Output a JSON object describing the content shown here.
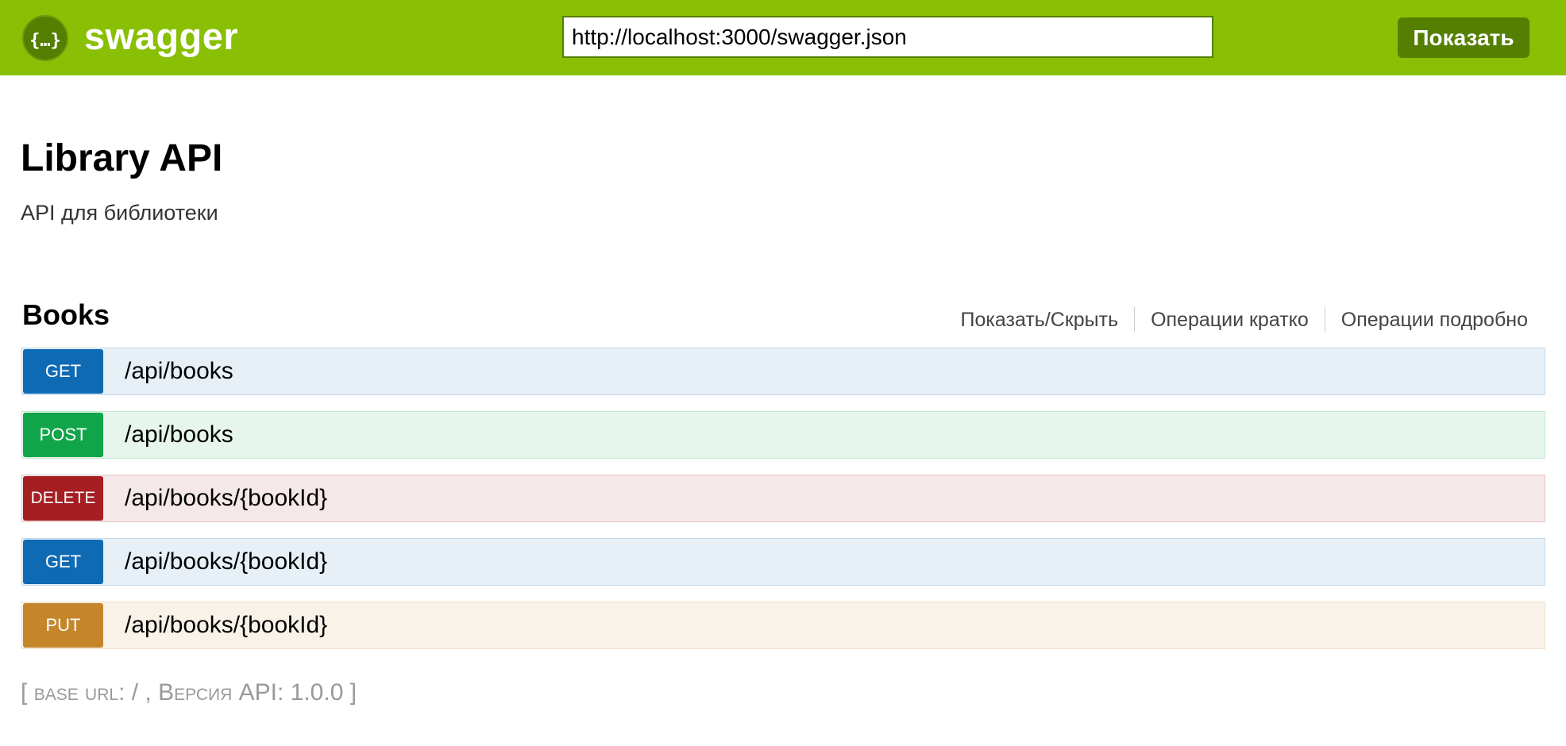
{
  "header": {
    "brand": "swagger",
    "logo_icon": "swagger-braces-icon",
    "url_value": "http://localhost:3000/swagger.json",
    "show_button": "Показать",
    "colors": {
      "bar": "#89bf04",
      "button": "#547f00"
    }
  },
  "info": {
    "title": "Library API",
    "description": "API для библиотеки"
  },
  "resource": {
    "name": "Books",
    "options": {
      "toggle": "Показать/Скрыть",
      "list": "Операции кратко",
      "expand": "Операции подробно"
    },
    "operations": [
      {
        "method": "GET",
        "path": "/api/books",
        "color": "#0f6ab4"
      },
      {
        "method": "POST",
        "path": "/api/books",
        "color": "#10a54a"
      },
      {
        "method": "DELETE",
        "path": "/api/books/{bookId}",
        "color": "#a41e22"
      },
      {
        "method": "GET",
        "path": "/api/books/{bookId}",
        "color": "#0f6ab4"
      },
      {
        "method": "PUT",
        "path": "/api/books/{bookId}",
        "color": "#c5862b"
      }
    ]
  },
  "footer": {
    "open_bracket": "[",
    "base_url_label": "base url",
    "base_url_value": ": / , ",
    "version_label": "Версия API",
    "version_value": ": 1.0.0 ",
    "close_bracket": "]"
  }
}
